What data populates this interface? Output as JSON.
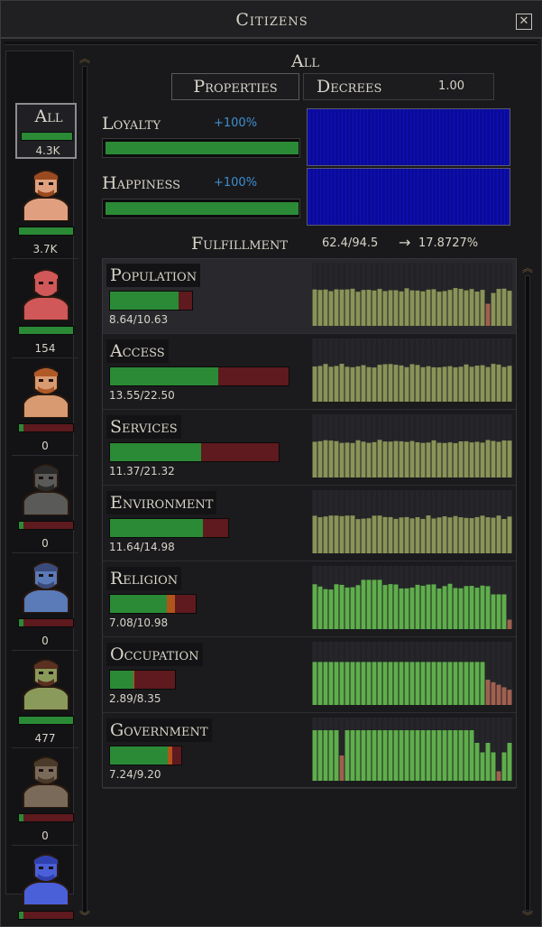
{
  "window": {
    "title": "Citizens",
    "close_icon": "close-icon"
  },
  "races": [
    {
      "label": "All",
      "count": "4.3K",
      "fill": 1.0,
      "selected": true
    },
    {
      "name": "human",
      "count": "3.7K",
      "fill": 1.0,
      "skin": "#e0a080",
      "hair": "#9a4a20"
    },
    {
      "name": "red-spiked",
      "count": "154",
      "fill": 1.0,
      "skin": "#d05858",
      "hair": "#d05858"
    },
    {
      "name": "dwarf",
      "count": "0",
      "fill": 0.08,
      "skin": "#d89a70",
      "hair": "#b05a28"
    },
    {
      "name": "dark-armored",
      "count": "0",
      "fill": 0.08,
      "skin": "#5a5a58",
      "hair": "#2a2a2a"
    },
    {
      "name": "blue-beast",
      "count": "0",
      "fill": 0.08,
      "skin": "#5a7ab8",
      "hair": "#3a4a7a"
    },
    {
      "name": "green-woman",
      "count": "477",
      "fill": 1.0,
      "skin": "#8a9a5a",
      "hair": "#5a3020"
    },
    {
      "name": "tentacled",
      "count": "0",
      "fill": 0.08,
      "skin": "#7a6a5a",
      "hair": "#4a3a2a"
    },
    {
      "name": "blue-stone",
      "count": "0",
      "fill": 0.08,
      "skin": "#4a60d8",
      "hair": "#3040b0"
    }
  ],
  "panel": {
    "heading": "All",
    "tabs": {
      "properties": "Properties",
      "decrees": "Decrees",
      "decrees_value": "1.00"
    },
    "loyalty": {
      "label": "Loyalty",
      "pct": "+100%",
      "fill": 1.0
    },
    "happiness": {
      "label": "Happiness",
      "pct": "+100%",
      "fill": 1.0
    },
    "fulfillment": {
      "label": "Fulfillment",
      "value": "62.4/94.5",
      "arrow": "→",
      "result": "17.8727%"
    }
  },
  "needs": [
    {
      "label": "Population",
      "value": "8.64/10.63",
      "fill": 0.813,
      "orange": 0,
      "bar_w": 93,
      "history": [
        0.62,
        0.6,
        0.6,
        0.62,
        0.6,
        0.6,
        0.62,
        0.6,
        0.6,
        0.6,
        0.62,
        0.6,
        0.6,
        0.6,
        0.62,
        0.6,
        0.6,
        0.6,
        0.6,
        0.62,
        0.6,
        0.6,
        0.6,
        0.62,
        0.6,
        0.6,
        0.62,
        0.6,
        0.6,
        0.6,
        0.6,
        0.6,
        0.62,
        0.6,
        0.6,
        0.6,
        0.6,
        0.6,
        0.6,
        0.6,
        0.6,
        0.6,
        0.6,
        0.6,
        0.6,
        0.6,
        0.6,
        0.6,
        0.6,
        0.6,
        0.6,
        0.6,
        0.6,
        0.6,
        0.6,
        0.6,
        0.6,
        0.6,
        0.6,
        0.6,
        0.62,
        0.6,
        0.6,
        0.6,
        0.6,
        0.62,
        0.6,
        0.6,
        0.6,
        0.6,
        0.6,
        0.6,
        0.6,
        0.6,
        0.6,
        0.6,
        0.6,
        0.6,
        0.6,
        0.6,
        0.6,
        0.6,
        0.6,
        0.6,
        0.38,
        0.56,
        0.6,
        0.6
      ],
      "tone": "olive",
      "selected": true
    },
    {
      "label": "Access",
      "value": "13.55/22.50",
      "fill": 0.602,
      "orange": 0,
      "bar_w": 200,
      "tone": "olive",
      "selected": false
    },
    {
      "label": "Services",
      "value": "11.37/21.32",
      "fill": 0.533,
      "orange": 0,
      "bar_w": 189,
      "tone": "olive",
      "selected": false
    },
    {
      "label": "Environment",
      "value": "11.64/14.98",
      "fill": 0.777,
      "orange": 0,
      "bar_w": 133,
      "tone": "olive",
      "selected": false
    },
    {
      "label": "Religion",
      "value": "7.08/10.98",
      "fill": 0.645,
      "orange": 0.1,
      "bar_w": 97,
      "tone": "green",
      "selected": false
    },
    {
      "label": "Occupation",
      "value": "2.89/8.35",
      "fill": 0.346,
      "orange": 0.02,
      "bar_w": 74,
      "tone": "green",
      "selected": false
    },
    {
      "label": "Government",
      "value": "7.24/9.20",
      "fill": 0.787,
      "orange": 0.07,
      "bar_w": 81,
      "tone": "green",
      "selected": false
    }
  ],
  "colors": {
    "green": "#2b8a36",
    "red": "#5e1a1e",
    "orange": "#b2551a",
    "blue_chart": "#0a0a9a",
    "olive": "#8a9358",
    "bright_green": "#5fae4c",
    "pink": "#a06050"
  }
}
